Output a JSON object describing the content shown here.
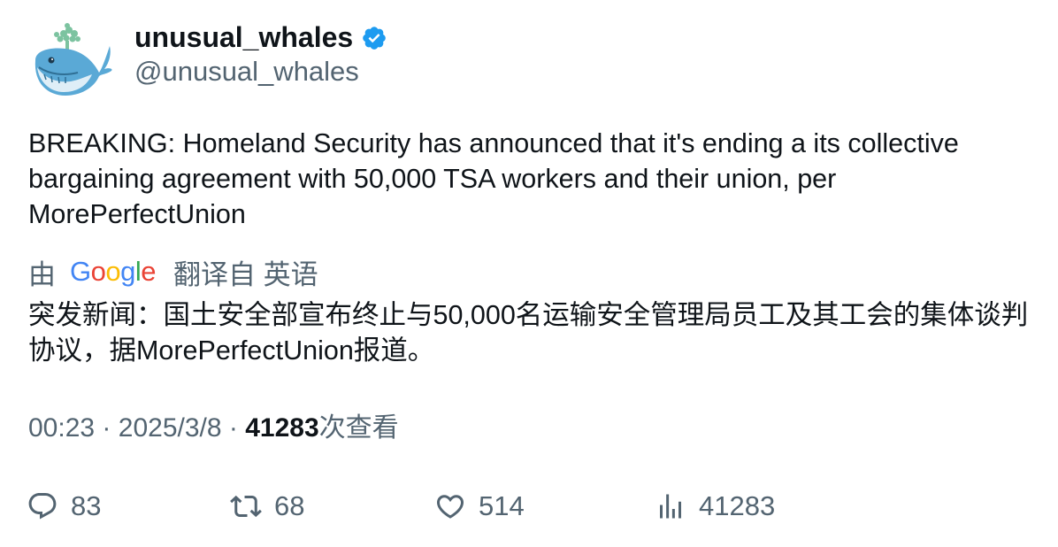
{
  "author": {
    "display_name": "unusual_whales",
    "handle": "@unusual_whales",
    "verified": true,
    "avatar_icon": "whale-icon"
  },
  "tweet": {
    "text": "BREAKING: Homeland Security has announced that it's ending a its collective bargaining agreement with 50,000 TSA workers and their union, per MorePerfectUnion"
  },
  "translation": {
    "prefix": "由",
    "provider": "Google",
    "suffix": "翻译自 英语",
    "text": "突发新闻：国土安全部宣布终止与50,000名运输安全管理局员工及其工会的集体谈判协议，据MorePerfectUnion报道。"
  },
  "meta": {
    "time": "00:23",
    "separator": "·",
    "date": "2025/3/8",
    "views_count": "41283",
    "views_label": "次查看"
  },
  "actions": {
    "replies": "83",
    "retweets": "68",
    "likes": "514",
    "views": "41283"
  },
  "colors": {
    "text_primary": "#0f1419",
    "text_secondary": "#536471",
    "verified_blue": "#1d9bf0"
  }
}
